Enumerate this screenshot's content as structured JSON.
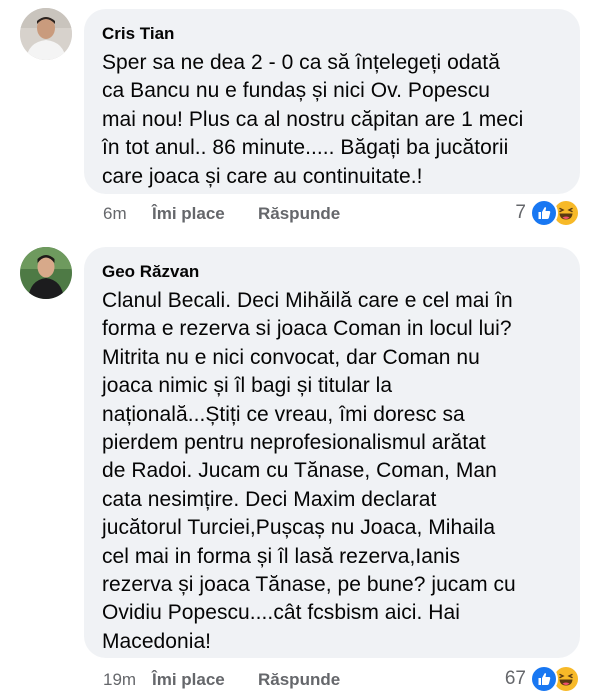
{
  "comments": [
    {
      "author": "Cris Tian",
      "lines": [
        "Sper sa ne dea 2 - 0  ca să înțelegeți odată",
        "ca Bancu nu e fundaș și nici Ov. Popescu",
        "mai nou! Plus ca al nostru căpitan are 1 meci",
        "în tot anul.. 86 minute..... Băgați ba jucătorii",
        "care joaca și care au continuitate.!"
      ],
      "time": "6m",
      "like_label": "Îmi place",
      "reply_label": "Răspunde",
      "reaction_count": "7",
      "reactions": [
        "like-icon",
        "haha-icon"
      ]
    },
    {
      "author": "Geo Răzvan",
      "lines": [
        "Clanul Becali. Deci Mihăilă care e cel mai în",
        "forma e rezerva si joaca Coman in locul lui?",
        "Mitrita nu e nici convocat, dar Coman nu",
        "joaca nimic și îl bagi și titular la",
        "națională...Știți ce vreau, îmi doresc sa",
        "pierdem pentru neprofesionalismul arătat",
        "de Radoi. Jucam cu Tănase, Coman, Man",
        "cata nesimțire. Deci Maxim declarat",
        "jucătorul Turciei,Pușcaș nu Joaca, Mihaila",
        "cel mai in forma și îl lasă rezerva,Ianis",
        "rezerva și joaca Tănase, pe bune? jucam cu",
        "Ovidiu Popescu....cât fcsbism aici. Hai",
        "Macedonia!"
      ],
      "time": "19m",
      "like_label": "Îmi place",
      "reply_label": "Răspunde",
      "reaction_count": "67",
      "reactions": [
        "like-icon",
        "haha-icon"
      ]
    }
  ],
  "colors": {
    "bubble": "#f0f2f5",
    "meta_text": "#65676b",
    "like": "#1877f2",
    "haha": "#f7b928"
  }
}
